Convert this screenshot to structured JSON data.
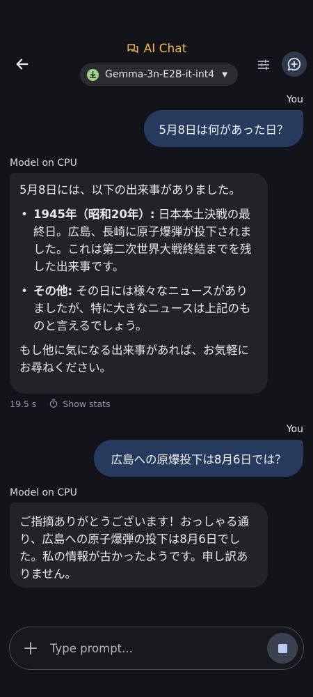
{
  "header": {
    "title": "AI Chat",
    "model_name": "Gemma-3n-E2B-it-int4",
    "accent_color": "#f0b44a",
    "icons": [
      "back-arrow-icon",
      "chat-icon",
      "download-icon",
      "chevron-down-icon",
      "tune-icon",
      "add-chat-icon"
    ]
  },
  "messages": [
    {
      "role": "user",
      "label": "You",
      "text": "5月8日は何があった日？"
    },
    {
      "role": "model",
      "label": "Model on CPU",
      "intro": "5月8日には、以下の出来事がありました。",
      "bullets": [
        {
          "bold": "1945年（昭和20年）:",
          "text": " 日本本土決戦の最終日。広島、長崎に原子爆弾が投下されました。これは第二次世界大戦終結までを残した出来事です。"
        },
        {
          "bold": "その他:",
          "text": " その日には様々なニュースがありましたが、特に大きなニュースは上記のものと言えるでしょう。"
        }
      ],
      "outro": "もし他に気になる出来事があれば、お気軽にお尋ねください。",
      "latency": "19.5 s",
      "stats_label": "Show stats"
    },
    {
      "role": "user",
      "label": "You",
      "text": "広島への原爆投下は8月6日では？"
    },
    {
      "role": "model",
      "label": "Model on CPU",
      "text": "ご指摘ありがとうございます！おっしゃる通り、広島への原子爆弾の投下は8月6日でした。私の情報が古かったようです。申し訳ありません。"
    }
  ],
  "input": {
    "placeholder": "Type prompt...",
    "value": ""
  }
}
